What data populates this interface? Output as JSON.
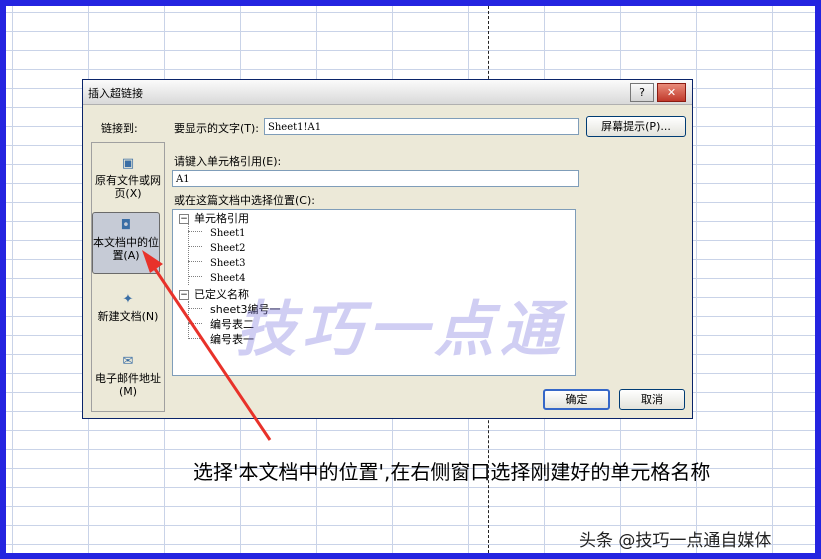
{
  "dialog": {
    "title": "插入超链接",
    "help_button": "?",
    "close_button": "✕",
    "link_to_label": "链接到:",
    "display_text_label": "要显示的文字(T):",
    "display_text_value": "Sheet1!A1",
    "screen_tip_button": "屏幕提示(P)...",
    "cell_ref_label": "请键入单元格引用(E):",
    "cell_ref_value": "A1",
    "select_place_label": "或在这篇文档中选择位置(C):",
    "ok_button": "确定",
    "cancel_button": "取消"
  },
  "link_types": [
    {
      "label": "原有文件或网页(X)",
      "icon": "file-globe-icon",
      "active": false
    },
    {
      "label": "本文档中的位置(A)",
      "icon": "document-place-icon",
      "active": true
    },
    {
      "label": "新建文档(N)",
      "icon": "new-document-icon",
      "active": false
    },
    {
      "label": "电子邮件地址(M)",
      "icon": "email-icon",
      "active": false
    }
  ],
  "tree": {
    "cell_refs": "单元格引用",
    "sheets": [
      "Sheet1",
      "Sheet2",
      "Sheet3",
      "Sheet4"
    ],
    "defined_names": "已定义名称",
    "names": [
      "sheet3编号一",
      "编号表二",
      "编号表一"
    ]
  },
  "watermark": "技巧一点通",
  "caption": "选择'本文档中的位置',在右侧窗口选择刚建好的单元格名称",
  "credit": "头条 @技巧一点通自媒体",
  "colors": {
    "frame": "#2424e0",
    "arrow": "#e8322a",
    "titlebar": "#d9d9d9",
    "watermark": "#7873dc"
  }
}
